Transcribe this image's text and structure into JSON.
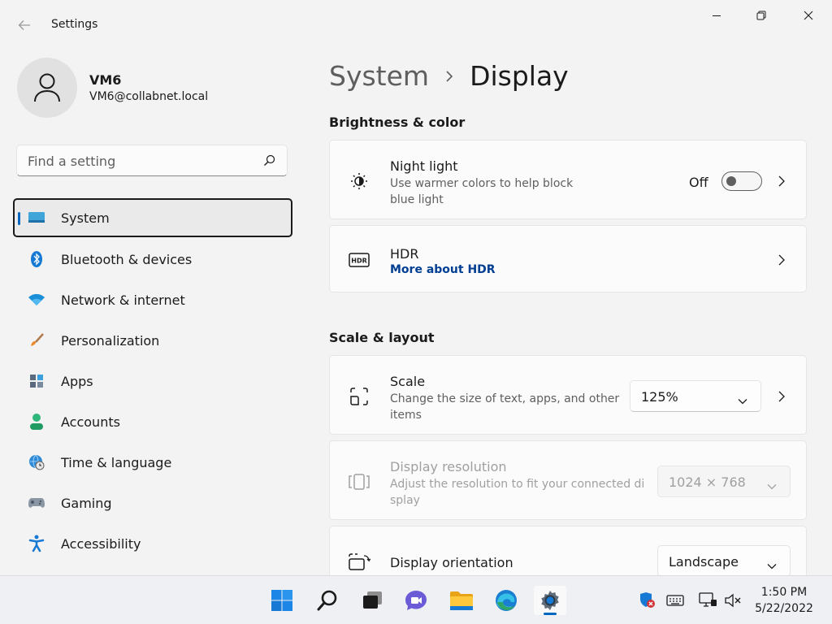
{
  "window": {
    "title": "Settings"
  },
  "profile": {
    "name": "VM6",
    "email": "VM6@collabnet.local"
  },
  "search": {
    "placeholder": "Find a setting"
  },
  "sidebar": {
    "items": [
      {
        "label": "System",
        "icon": "monitor-icon",
        "active": true
      },
      {
        "label": "Bluetooth & devices",
        "icon": "bluetooth-icon"
      },
      {
        "label": "Network & internet",
        "icon": "wifi-icon"
      },
      {
        "label": "Personalization",
        "icon": "paintbrush-icon"
      },
      {
        "label": "Apps",
        "icon": "apps-icon"
      },
      {
        "label": "Accounts",
        "icon": "person-icon"
      },
      {
        "label": "Time & language",
        "icon": "globe-clock-icon"
      },
      {
        "label": "Gaming",
        "icon": "gamepad-icon"
      },
      {
        "label": "Accessibility",
        "icon": "accessibility-icon"
      }
    ]
  },
  "breadcrumb": {
    "parent": "System",
    "current": "Display"
  },
  "sections": {
    "brightness": "Brightness & color",
    "scale_layout": "Scale & layout"
  },
  "night_light": {
    "title": "Night light",
    "desc_line1": "Use warmer colors to help block",
    "desc_line2": "blue light",
    "state": "Off"
  },
  "hdr": {
    "title": "HDR",
    "link": "More about HDR"
  },
  "scale": {
    "title": "Scale",
    "desc_line1": "Change the size of text, apps, and other",
    "desc_line2": "items",
    "value": "125%"
  },
  "resolution": {
    "title": "Display resolution",
    "desc_line1": "Adjust the resolution to fit your connected di",
    "desc_line2": "splay",
    "value": "1024 × 768"
  },
  "orientation": {
    "title": "Display orientation",
    "value": "Landscape"
  },
  "taskbar": {
    "apps": [
      "start-icon",
      "search-icon",
      "task-view-icon",
      "chat-icon",
      "file-explorer-icon",
      "edge-icon",
      "settings-icon"
    ],
    "time": "1:50 PM",
    "date": "5/22/2022"
  },
  "colors": {
    "accent": "#0067c0",
    "link": "#003e92"
  }
}
